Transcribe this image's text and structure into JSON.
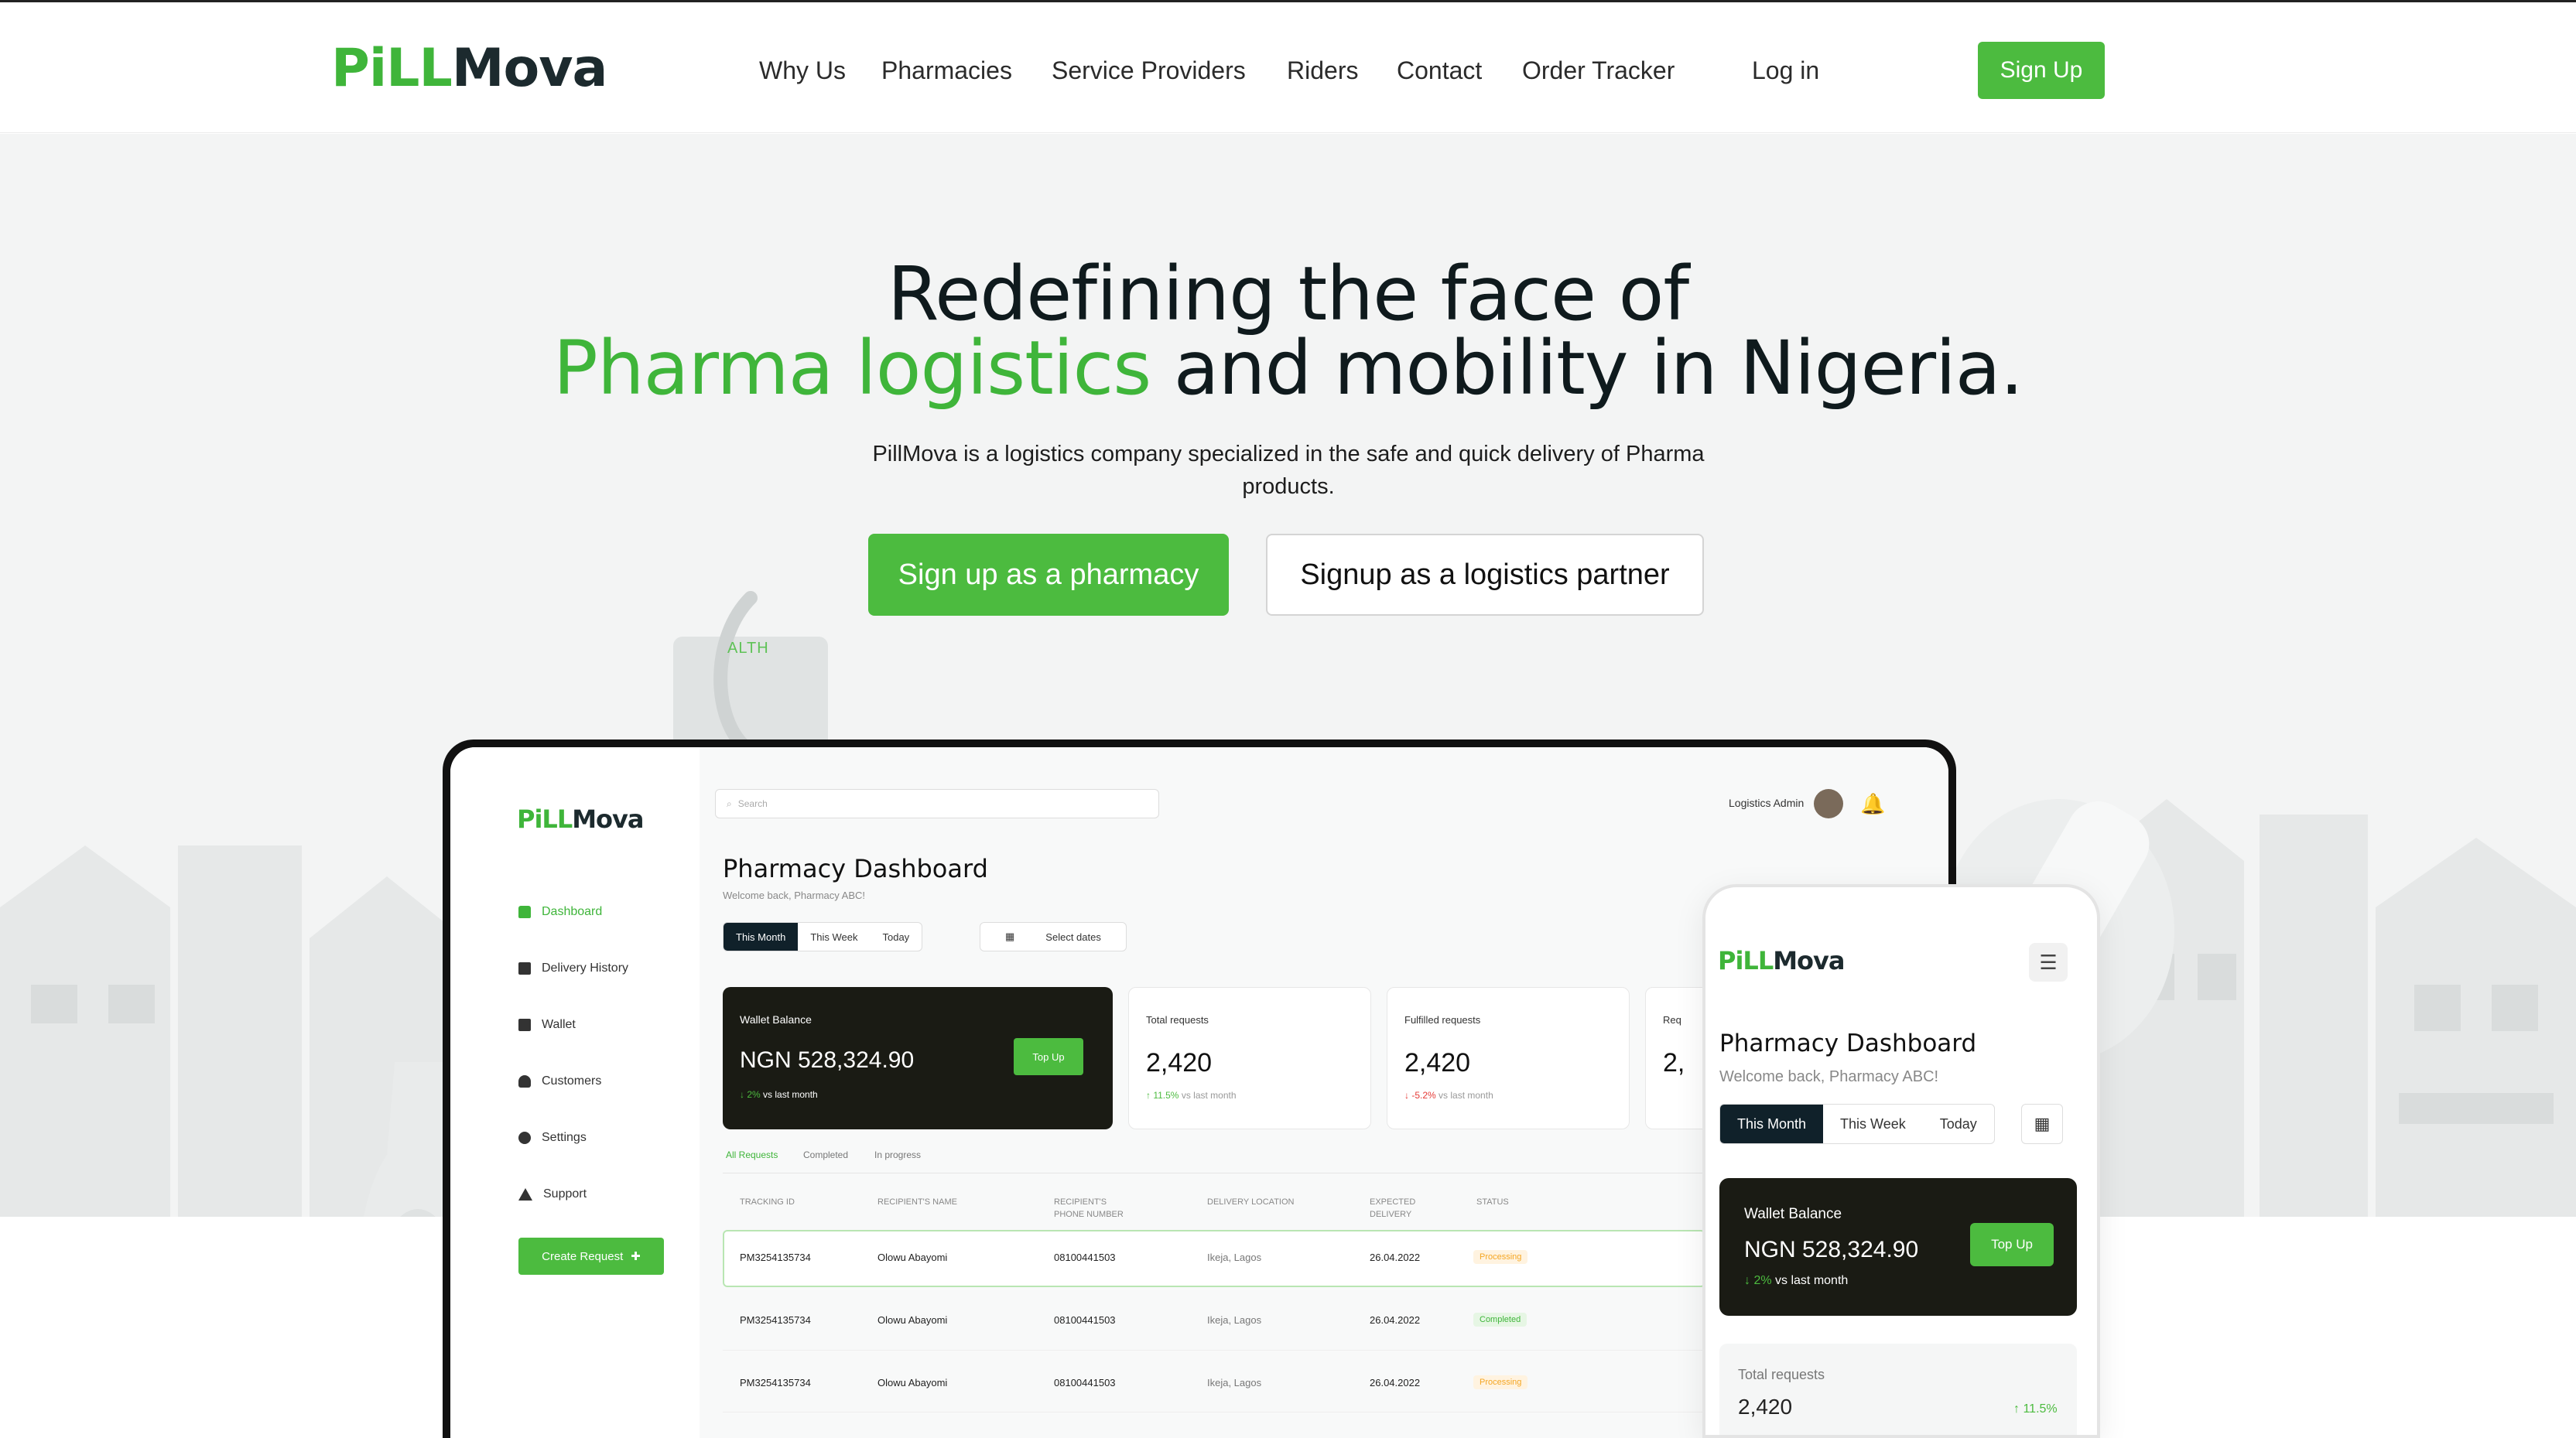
{
  "nav": {
    "logo": {
      "p": "PiLL",
      "m": "Mova"
    },
    "links": [
      "Why Us",
      "Pharmacies",
      "Service Providers",
      "Riders",
      "Contact",
      "Order Tracker"
    ],
    "login": "Log in",
    "signup": "Sign Up"
  },
  "hero": {
    "line1": "Redefining the face of",
    "line2_green": "Pharma logistics",
    "line2_rest": " and mobility in Nigeria.",
    "subtitle": "PillMova is a logistics company specialized in the safe and quick delivery of Pharma products.",
    "cta_pharmacy": "Sign up as a pharmacy",
    "cta_logistics": "Signup as a logistics partner",
    "bg_sign": "ALTH"
  },
  "dashboard": {
    "logo": {
      "p": "PiLL",
      "m": "Mova"
    },
    "sidebar": [
      "Dashboard",
      "Delivery History",
      "Wallet",
      "Customers",
      "Settings",
      "Support"
    ],
    "create_request": "Create Request",
    "search_placeholder": "Search",
    "user": "Logistics Admin",
    "title": "Pharmacy Dashboard",
    "welcome": "Welcome back, Pharmacy ABC!",
    "periods": [
      "This Month",
      "This Week",
      "Today"
    ],
    "select_dates": "Select dates",
    "wallet": {
      "label": "Wallet Balance",
      "amount": "NGN 528,324.90",
      "change": "2%",
      "vs": "vs last month",
      "topup": "Top Up"
    },
    "stats": [
      {
        "label": "Total requests",
        "value": "2,420",
        "change": "11.5%",
        "vs": "vs last month"
      },
      {
        "label": "Fulfilled requests",
        "value": "2,420",
        "change": "-5.2%",
        "vs": "vs last month"
      },
      {
        "label": "Req",
        "value": "2,"
      }
    ],
    "tabs": [
      "All Requests",
      "Completed",
      "In progress"
    ],
    "columns": [
      "TRACKING ID",
      "RECIPIENT'S NAME",
      "RECIPIENT'S PHONE NUMBER",
      "DELIVERY LOCATION",
      "EXPECTED DELIVERY",
      "STATUS"
    ],
    "rows": [
      {
        "id": "PM3254135734",
        "name": "Olowu Abayomi",
        "phone": "08100441503",
        "loc": "Ikeja, Lagos",
        "date": "26.04.2022",
        "status": "Processing"
      },
      {
        "id": "PM3254135734",
        "name": "Olowu Abayomi",
        "phone": "08100441503",
        "loc": "Ikeja, Lagos",
        "date": "26.04.2022",
        "status": "Completed"
      },
      {
        "id": "PM3254135734",
        "name": "Olowu Abayomi",
        "phone": "08100441503",
        "loc": "Ikeja, Lagos",
        "date": "26.04.2022",
        "status": "Processing"
      }
    ]
  },
  "mobile": {
    "logo": {
      "p": "PiLL",
      "m": "Mova"
    },
    "title": "Pharmacy Dashboard",
    "welcome": "Welcome back, Pharmacy ABC!",
    "periods": [
      "This Month",
      "This Week",
      "Today"
    ],
    "wallet": {
      "label": "Wallet Balance",
      "amount": "NGN 528,324.90",
      "change": "2%",
      "vs": "vs last month",
      "topup": "Top Up"
    },
    "stat": {
      "label": "Total requests",
      "value": "2,420",
      "change": "11.5%"
    }
  },
  "colors": {
    "brand_green": "#4cbb3f",
    "dark": "#10212a",
    "processing": "#f5a623",
    "completed": "#3fb53a",
    "down": "#e53935"
  }
}
